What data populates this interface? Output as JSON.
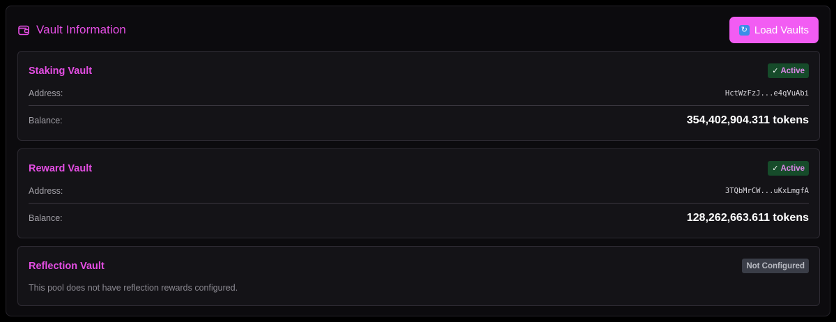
{
  "header": {
    "title": "Vault Information",
    "load_button_label": "Load Vaults"
  },
  "vaults": [
    {
      "name": "Staking Vault",
      "status": "Active",
      "address_label": "Address:",
      "address": "HctWzFzJ...e4qVuAbi",
      "balance_label": "Balance:",
      "balance": "354,402,904.311 tokens"
    },
    {
      "name": "Reward Vault",
      "status": "Active",
      "address_label": "Address:",
      "address": "3TQbMrCW...uKxLmgfA",
      "balance_label": "Balance:",
      "balance": "128,262,663.611 tokens"
    },
    {
      "name": "Reflection Vault",
      "status": "Not Configured",
      "note": "This pool does not have reflection rewards configured."
    }
  ],
  "colors": {
    "accent": "#e54ee4",
    "button": "#f25cf3",
    "active_badge_bg": "#164b2a",
    "inactive_badge_bg": "#3a3d47"
  },
  "icons": {
    "title_icon": "wallet-icon",
    "button_icon": "refresh-icon"
  }
}
